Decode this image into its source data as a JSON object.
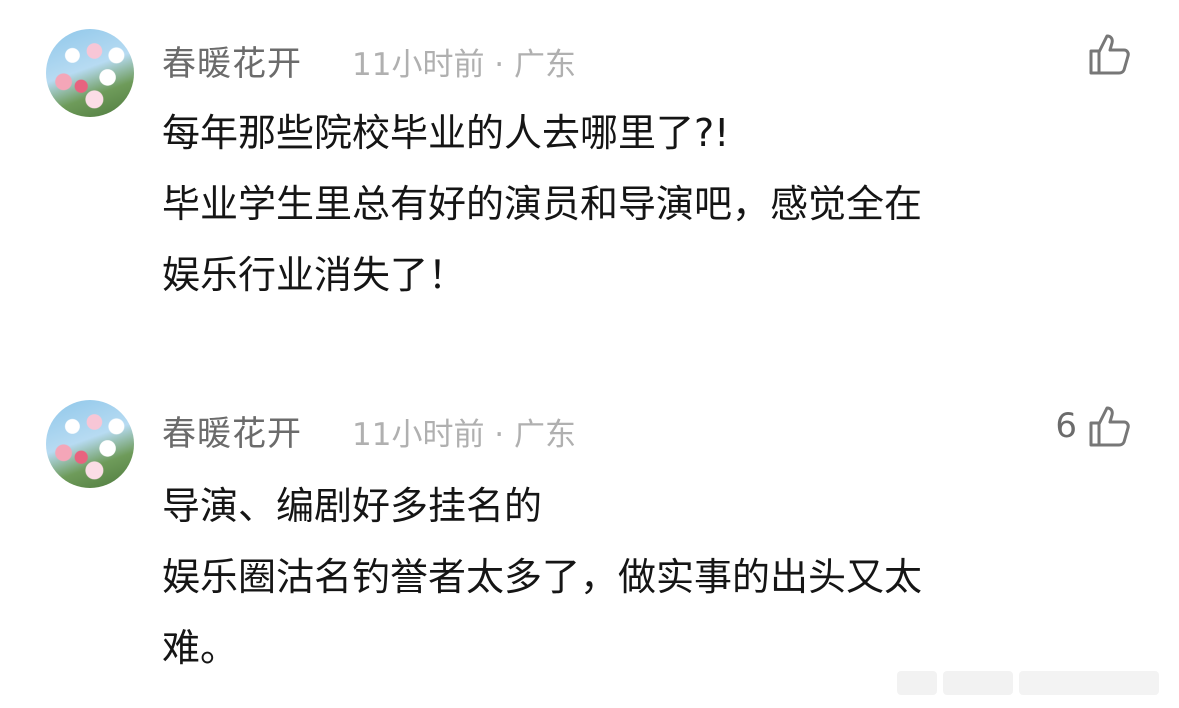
{
  "comments": [
    {
      "username": "春暖花开",
      "meta": "11小时前 · 广东",
      "like_count": "",
      "lines": [
        "每年那些院校毕业的人去哪里了?!",
        "毕业学生里总有好的演员和导演吧，感觉全在",
        "娱乐行业消失了！"
      ]
    },
    {
      "username": "春暖花开",
      "meta": "11小时前 · 广东",
      "like_count": "6",
      "lines": [
        "导演、编剧好多挂名的",
        "娱乐圈沽名钓誉者太多了，做实事的出头又太",
        "难。"
      ]
    }
  ],
  "icons": {
    "like": "thumbs-up-icon",
    "avatar": "cherry-blossom-avatar"
  },
  "colors": {
    "username": "#6b6b6b",
    "meta": "#b0b0b0",
    "text": "#151515",
    "background": "#ffffff"
  }
}
